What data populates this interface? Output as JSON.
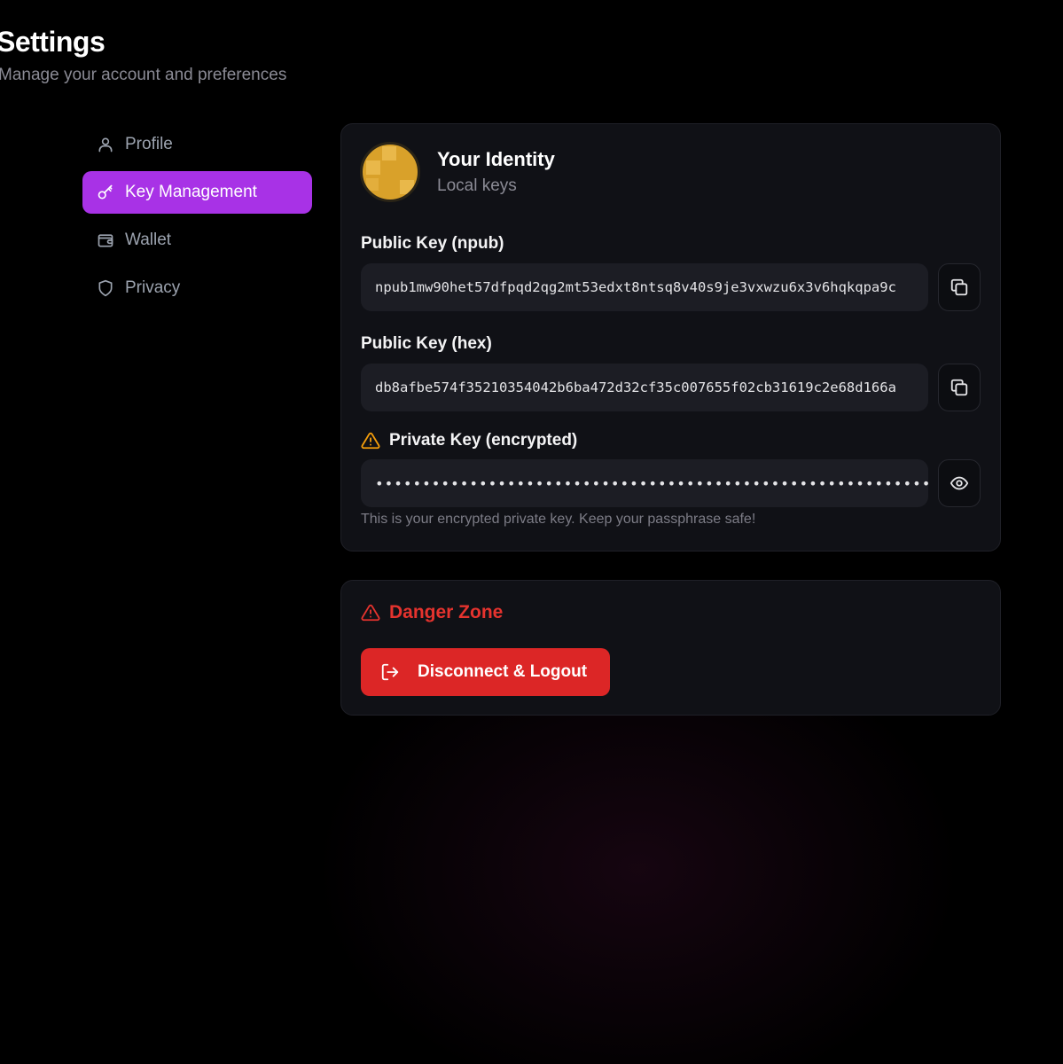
{
  "header": {
    "title": "Settings",
    "subtitle": "Manage your account and preferences"
  },
  "sidebar": {
    "items": [
      {
        "label": "Profile",
        "icon": "user-icon",
        "active": false
      },
      {
        "label": "Key Management",
        "icon": "key-icon",
        "active": true
      },
      {
        "label": "Wallet",
        "icon": "wallet-icon",
        "active": false
      },
      {
        "label": "Privacy",
        "icon": "shield-icon",
        "active": false
      }
    ]
  },
  "identity": {
    "title": "Your Identity",
    "subtitle": "Local keys",
    "npub_label": "Public Key (npub)",
    "npub_value": "npub1mw90het57dfpqd2qg2mt53edxt8ntsq8v40s9je3vxwzu6x3v6hqkqpa9c",
    "hex_label": "Public Key (hex)",
    "hex_value": "db8afbe574f35210354042b6ba472d32cf35c007655f02cb31619c2e68d166a",
    "private_label": "Private Key (encrypted)",
    "private_value": "••••••••••••••••••••••••••••••••••••••••••••••••••••••••••••••",
    "hint": "This is your encrypted private key. Keep your passphrase safe!"
  },
  "danger": {
    "title": "Danger Zone",
    "logout_label": "Disconnect & Logout"
  },
  "colors": {
    "accent": "#a832e6",
    "danger": "#dc2626",
    "warning": "#f59e0b",
    "card_bg": "#101116"
  }
}
